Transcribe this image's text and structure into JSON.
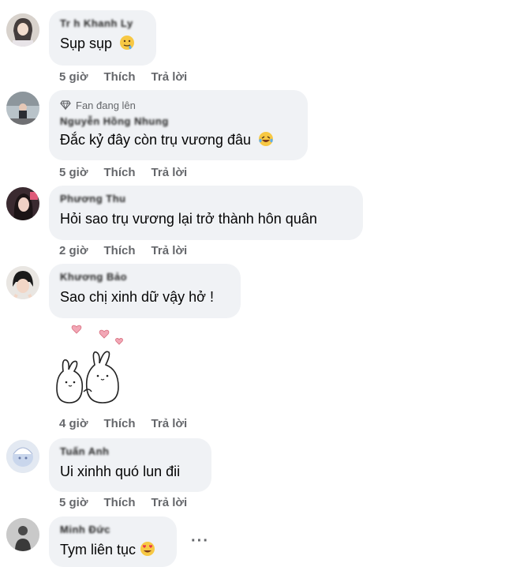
{
  "comments": [
    {
      "author": "Tr h Khanh Ly",
      "text": "Sụp sụp",
      "time": "5 giờ",
      "like": "Thích",
      "reply": "Trả lời"
    },
    {
      "badge": "Fan đang lên",
      "author": "Nguyễn Hồng Nhung",
      "text": "Đắc kỷ đây còn trụ vương đâu",
      "time": "5 giờ",
      "like": "Thích",
      "reply": "Trả lời"
    },
    {
      "author": "Phương Thu",
      "text": "Hỏi sao trụ vương lại trở thành hôn quân",
      "time": "2 giờ",
      "like": "Thích",
      "reply": "Trả lời"
    },
    {
      "author": "Khương Bảo",
      "text": "Sao chị xinh dữ vậy hở !",
      "time": "4 giờ",
      "like": "Thích",
      "reply": "Trả lời"
    },
    {
      "author": "Tuấn Anh",
      "text": "Ui xinhh quó lun đii",
      "time": "5 giờ",
      "like": "Thích",
      "reply": "Trả lời"
    },
    {
      "author": "Minh Đức",
      "text": "Tym liên tục",
      "more": "···"
    }
  ],
  "colors": {
    "bubble": "#f0f2f5",
    "meta": "#65676b",
    "text": "#050505"
  }
}
